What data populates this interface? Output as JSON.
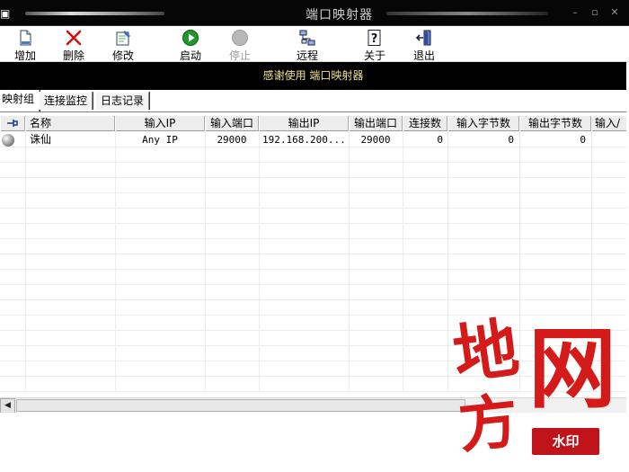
{
  "window": {
    "title": "端口映射器",
    "icon_glyph": "▣",
    "controls": [
      "–",
      "▫",
      "✕"
    ]
  },
  "toolbar": {
    "items": [
      {
        "label": "增加",
        "icon": "add-page-icon"
      },
      {
        "label": "删除",
        "icon": "delete-x-icon"
      },
      {
        "label": "修改",
        "icon": "edit-icon"
      },
      {
        "label": "启动",
        "icon": "play-icon"
      },
      {
        "label": "停止",
        "icon": "stop-icon",
        "disabled": true
      },
      {
        "label": "远程",
        "icon": "remote-network-icon"
      },
      {
        "label": "关于",
        "icon": "help-icon"
      },
      {
        "label": "退出",
        "icon": "exit-door-icon"
      }
    ]
  },
  "banner": {
    "text": "感谢使用 端口映射器"
  },
  "tabs": [
    {
      "label": "映射组",
      "active": true
    },
    {
      "label": "连接监控"
    },
    {
      "label": "日志记录"
    }
  ],
  "list": {
    "columns": [
      "名称",
      "输入IP",
      "输入端口",
      "输出IP",
      "输出端口",
      "连接数",
      "输入字节数",
      "输出字节数",
      "输入/"
    ],
    "rows": [
      {
        "name": "诛仙",
        "in_ip": "Any IP",
        "in_port": "29000",
        "out_ip": "192.168.200...",
        "out_port": "29000",
        "conns": "0",
        "in_bytes": "0",
        "out_bytes": "0"
      }
    ]
  },
  "watermark": {
    "chars": [
      "地",
      "方",
      "网"
    ],
    "stamp": "水印"
  },
  "colors": {
    "titlebar": "#060606",
    "banner_bg": "#000000",
    "banner_text": "#f0e28a",
    "watermark": "#d51a1a"
  }
}
